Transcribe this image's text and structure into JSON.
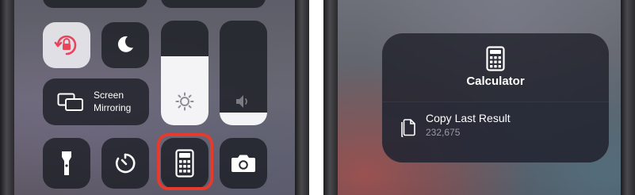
{
  "left": {
    "screen_mirroring": {
      "line1": "Screen",
      "line2": "Mirroring"
    },
    "brightness_level": 0.66,
    "volume_level": 0.12,
    "icons": [
      "rotation-lock-icon",
      "moon-icon",
      "sun-icon",
      "speaker-icon",
      "screen-mirroring-icon",
      "flashlight-icon",
      "timer-icon",
      "calculator-icon",
      "camera-icon"
    ],
    "highlight_color": "#e53a2e"
  },
  "right": {
    "popup": {
      "title": "Calculator",
      "action": {
        "label": "Copy Last Result",
        "value": "232,675"
      }
    },
    "icons": [
      "calculator-icon",
      "copy-icon"
    ]
  }
}
